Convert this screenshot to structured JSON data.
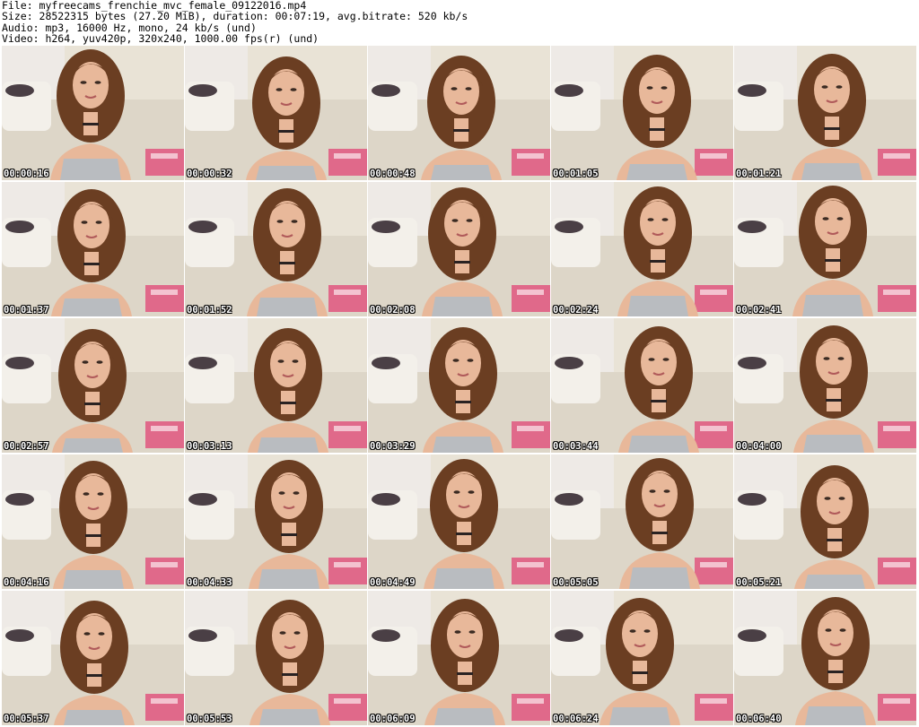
{
  "header": {
    "file_line": "File: myfreecams_frenchie_mvc_female_09122016.mp4",
    "size_line": "Size: 28522315 bytes (27.20 MiB), duration: 00:07:19, avg.bitrate: 520 kb/s",
    "audio_line": "Audio: mp3, 16000 Hz, mono, 24 kb/s (und)",
    "video_line": "Video: h264, yuv420p, 320x240, 1000.00 fps(r) (und)"
  },
  "thumbnails": [
    {
      "timestamp": "00:00:16"
    },
    {
      "timestamp": "00:00:32"
    },
    {
      "timestamp": "00:00:48"
    },
    {
      "timestamp": "00:01:05"
    },
    {
      "timestamp": "00:01:21"
    },
    {
      "timestamp": "00:01:37"
    },
    {
      "timestamp": "00:01:52"
    },
    {
      "timestamp": "00:02:08"
    },
    {
      "timestamp": "00:02:24"
    },
    {
      "timestamp": "00:02:41"
    },
    {
      "timestamp": "00:02:57"
    },
    {
      "timestamp": "00:03:13"
    },
    {
      "timestamp": "00:03:29"
    },
    {
      "timestamp": "00:03:44"
    },
    {
      "timestamp": "00:04:00"
    },
    {
      "timestamp": "00:04:16"
    },
    {
      "timestamp": "00:04:33"
    },
    {
      "timestamp": "00:04:49"
    },
    {
      "timestamp": "00:05:05"
    },
    {
      "timestamp": "00:05:21"
    },
    {
      "timestamp": "00:05:37"
    },
    {
      "timestamp": "00:05:53"
    },
    {
      "timestamp": "00:06:09"
    },
    {
      "timestamp": "00:06:24"
    },
    {
      "timestamp": "00:06:40"
    }
  ],
  "colors": {
    "background": "#ffffff",
    "wall": "#e9e3d6",
    "sofa": "#f3f0ea",
    "pillow": "#4a3f45",
    "hair": "#6b3e22",
    "skin": "#e8b89a",
    "top": "#b9bcc0",
    "pink_box": "#e0567f"
  }
}
